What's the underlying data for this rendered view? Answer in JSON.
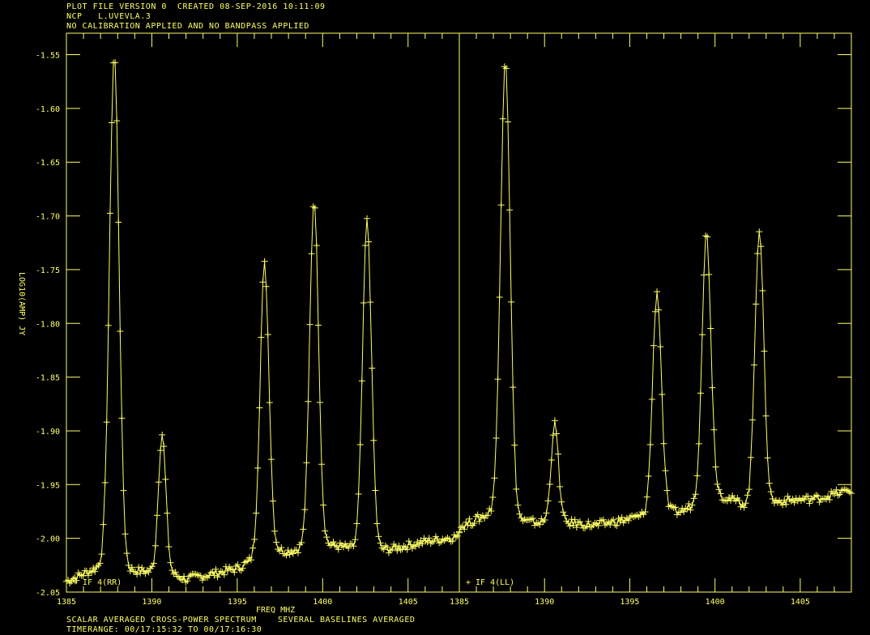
{
  "header": {
    "line1": "PLOT FILE VERSION 0  CREATED 08-SEP-2016 10:11:09",
    "line2": "NCP   L.UVEVLA.3",
    "line3": "NO CALIBRATION APPLIED AND NO BANDPASS APPLIED"
  },
  "footer": {
    "line1": "SCALAR AVERAGED CROSS-POWER SPECTRUM    SEVERAL BASELINES AVERAGED",
    "line2": "TIMERANGE: 00/17:15:32 TO 00/17:16:30"
  },
  "colors": {
    "fg": "#ffff66",
    "bg": "#000000"
  },
  "chart_data": {
    "type": "line",
    "markers": "plus",
    "ylabel": "LOG10(AMP) JY",
    "xlabel": "FREQ MHZ",
    "ylim": [
      -2.05,
      -1.53
    ],
    "yticks": [
      -2.05,
      -2.0,
      -1.95,
      -1.9,
      -1.85,
      -1.8,
      -1.75,
      -1.7,
      -1.65,
      -1.6,
      -1.55
    ],
    "ytick_labels": [
      "-2.05",
      "-2.00",
      "-1.95",
      "-1.90",
      "-1.85",
      "-1.80",
      "-1.75",
      "-1.70",
      "-1.65",
      "-1.60",
      "-1.55"
    ],
    "grid": false,
    "panels": [
      {
        "name": "IF 4(RR)",
        "xlim": [
          1385,
          1408
        ],
        "xticks": [
          1385,
          1390,
          1395,
          1400,
          1405
        ],
        "baseline": {
          "x": [
            1385,
            1387,
            1389,
            1391,
            1392,
            1393,
            1395,
            1397,
            1398,
            1400,
            1402,
            1404,
            1406,
            1408
          ],
          "y": [
            -2.04,
            -2.026,
            -2.03,
            -2.032,
            -2.038,
            -2.035,
            -2.028,
            -2.01,
            -2.012,
            -2.005,
            -2.01,
            -2.01,
            -2.003,
            -1.998
          ]
        },
        "peaks": [
          {
            "x": 1387.8,
            "y": -1.55,
            "width": 0.28
          },
          {
            "x": 1390.6,
            "y": -1.903,
            "width": 0.22
          },
          {
            "x": 1396.6,
            "y": -1.745,
            "width": 0.26
          },
          {
            "x": 1399.5,
            "y": -1.684,
            "width": 0.26
          },
          {
            "x": 1402.6,
            "y": -1.705,
            "width": 0.26
          }
        ]
      },
      {
        "name": "IF 4(LL)",
        "xlim": [
          1385,
          1408
        ],
        "xticks": [
          1385,
          1390,
          1395,
          1400,
          1405
        ],
        "baseline": {
          "x": [
            1385,
            1387,
            1389,
            1391,
            1393,
            1395,
            1396,
            1397,
            1398,
            1400,
            1402,
            1404,
            1406,
            1408
          ],
          "y": [
            -1.99,
            -1.975,
            -1.985,
            -1.985,
            -1.988,
            -1.982,
            -1.978,
            -1.975,
            -1.975,
            -1.958,
            -1.97,
            -1.965,
            -1.963,
            -1.955
          ]
        },
        "peaks": [
          {
            "x": 1387.7,
            "y": -1.553,
            "width": 0.28
          },
          {
            "x": 1390.6,
            "y": -1.894,
            "width": 0.22
          },
          {
            "x": 1396.6,
            "y": -1.771,
            "width": 0.26
          },
          {
            "x": 1399.5,
            "y": -1.716,
            "width": 0.26
          },
          {
            "x": 1402.6,
            "y": -1.712,
            "width": 0.26
          }
        ]
      }
    ]
  }
}
